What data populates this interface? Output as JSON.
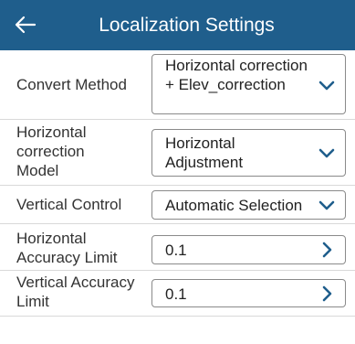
{
  "header": {
    "title": "Localization Settings"
  },
  "rows": [
    {
      "label": "Convert Method",
      "value": "Horizontal correction + Elev_correction",
      "control": "dropdown"
    },
    {
      "label": "Horizontal correction Model",
      "value": "Horizontal Adjustment",
      "control": "dropdown"
    },
    {
      "label": "Vertical Control",
      "value": "Automatic Selection",
      "control": "dropdown"
    },
    {
      "label": "Horizontal Accuracy Limit",
      "value": "0.1",
      "control": "navigate"
    },
    {
      "label": "Vertical Accuracy Limit",
      "value": "0.1",
      "control": "navigate"
    }
  ],
  "icons": {
    "back": "arrow-left-icon",
    "dropdown": "chevron-down-icon",
    "navigate": "chevron-right-icon"
  },
  "colors": {
    "header_bg": "#1f5e8c",
    "chevron": "#1f5e8c"
  }
}
